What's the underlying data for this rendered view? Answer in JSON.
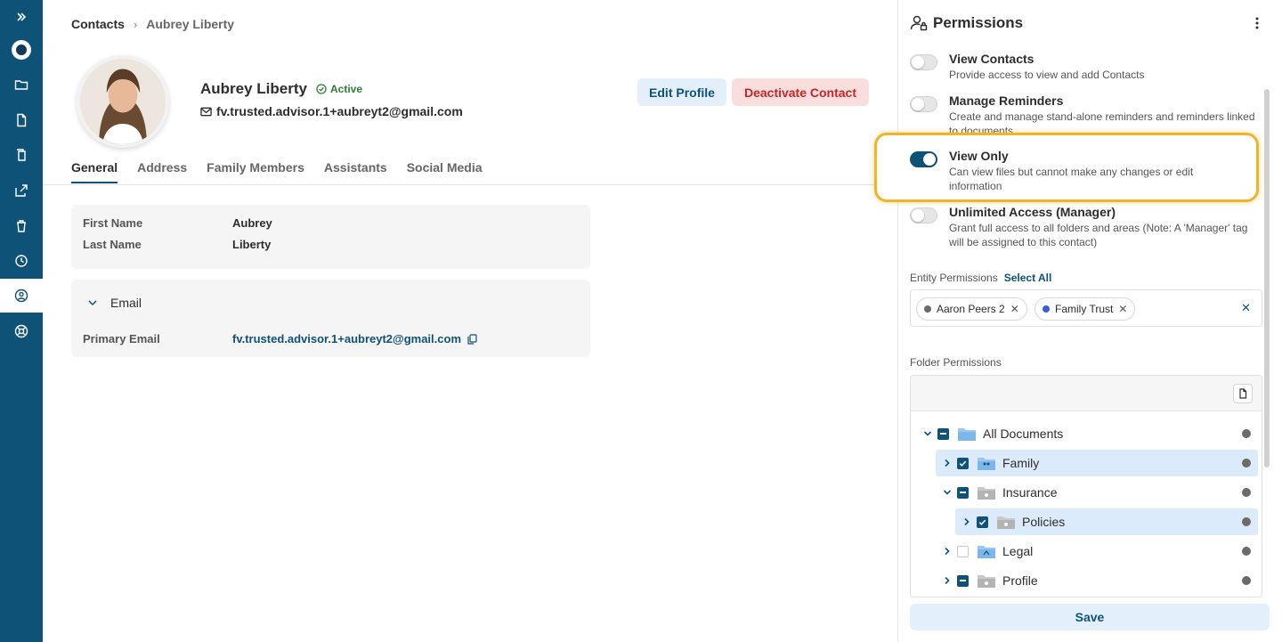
{
  "breadcrumb": {
    "parent": "Contacts",
    "current": "Aubrey Liberty"
  },
  "profile": {
    "name": "Aubrey Liberty",
    "status": "Active",
    "email": "fv.trusted.advisor.1+aubreyt2@gmail.com",
    "edit_label": "Edit Profile",
    "deactivate_label": "Deactivate Contact"
  },
  "tabs": [
    {
      "label": "General",
      "active": true
    },
    {
      "label": "Address"
    },
    {
      "label": "Family Members"
    },
    {
      "label": "Assistants"
    },
    {
      "label": "Social Media"
    }
  ],
  "general": {
    "first_name_label": "First Name",
    "first_name": "Aubrey",
    "last_name_label": "Last Name",
    "last_name": "Liberty"
  },
  "email_section": {
    "title": "Email",
    "primary_label": "Primary Email",
    "primary_value": "fv.trusted.advisor.1+aubreyt2@gmail.com"
  },
  "permissions": {
    "title": "Permissions",
    "items": [
      {
        "name": "View Contacts",
        "desc": "Provide access to view and add Contacts",
        "enabled": false
      },
      {
        "name": "Manage Reminders",
        "desc": "Create and manage stand-alone reminders and reminders linked to documents",
        "enabled": false
      },
      {
        "name": "View Only",
        "desc": "Can view files but cannot make any changes or edit information",
        "enabled": true
      },
      {
        "name": "Unlimited Access (Manager)",
        "desc": "Grant full access to all folders and areas (Note: A 'Manager' tag will be assigned to this contact)",
        "enabled": false
      }
    ],
    "entity_label": "Entity Permissions",
    "select_all": "Select All",
    "entities": [
      {
        "name": "Aaron Peers 2",
        "color": "#6b6b6b"
      },
      {
        "name": "Family Trust",
        "color": "#3b5bdb"
      }
    ],
    "clear_icon": "close-icon",
    "folder_label": "Folder Permissions",
    "folders": [
      {
        "name": "All Documents",
        "state": "partial",
        "expanded": true
      },
      {
        "name": "Family",
        "state": "checked",
        "expanded": false,
        "selected": true
      },
      {
        "name": "Insurance",
        "state": "partial",
        "expanded": true
      },
      {
        "name": "Policies",
        "state": "checked",
        "expanded": false,
        "selected": true
      },
      {
        "name": "Legal",
        "state": "unchecked",
        "expanded": false
      },
      {
        "name": "Profile",
        "state": "partial",
        "expanded": false
      }
    ],
    "save_label": "Save"
  },
  "colors": {
    "primary": "#0f5277",
    "highlight": "#f0b429",
    "danger": "#c62828",
    "active_status": "#2e7d32"
  },
  "rail_icons": [
    "expand-icon",
    "shield-logo-icon",
    "folder-icon",
    "document-icon",
    "copy-icon",
    "share-icon",
    "trash-icon",
    "clock-icon",
    "contacts-icon",
    "help-icon"
  ]
}
